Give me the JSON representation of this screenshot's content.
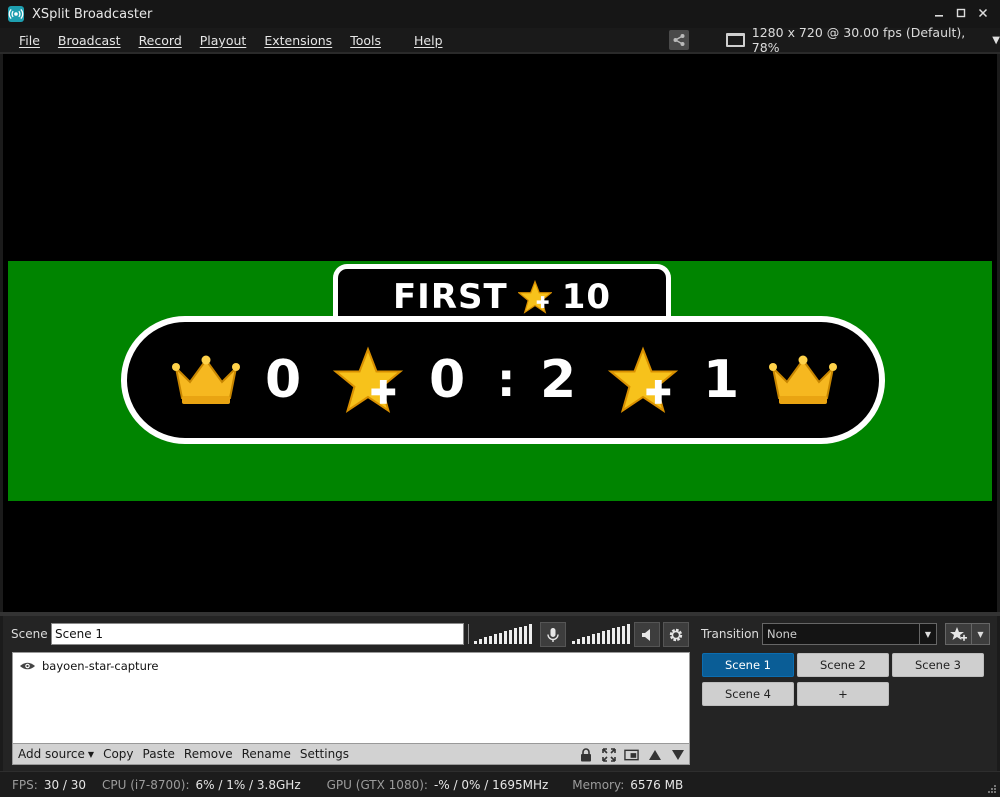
{
  "window": {
    "title": "XSplit Broadcaster",
    "app_icon": "broadcast-icon",
    "controls": [
      "minimize-icon",
      "maximize-icon",
      "close-icon"
    ]
  },
  "menu": {
    "items": [
      "File",
      "Broadcast",
      "Record",
      "Playout",
      "Extensions",
      "Tools",
      "Help"
    ],
    "resolution": "1280 x 720 @ 30.00 fps (Default), 78%"
  },
  "preview": {
    "background_color": "#008400",
    "badge": {
      "label": "FIRST",
      "target": "10"
    },
    "scoreboard": {
      "left_score": "0",
      "left_stars": "0",
      "separator": ":",
      "right_stars": "2",
      "right_score": "1"
    },
    "icons": [
      "crown-icon",
      "star-plus-icon"
    ]
  },
  "scene_panel": {
    "scene_label": "Scene",
    "scene_name": "Scene 1",
    "sources": [
      {
        "name": "bayoen-star-capture",
        "visible": true
      }
    ],
    "toolbar": {
      "add_source": "Add source",
      "copy": "Copy",
      "paste": "Paste",
      "remove": "Remove",
      "rename": "Rename",
      "settings": "Settings"
    }
  },
  "transition": {
    "label": "Transition",
    "value": "None"
  },
  "scenes": {
    "items": [
      "Scene 1",
      "Scene 2",
      "Scene 3",
      "Scene 4"
    ],
    "add_label": "+",
    "active": "Scene 1",
    "active_color": "#0a5d96"
  },
  "status": {
    "fps_label": "FPS:",
    "fps_value": "30 / 30",
    "cpu_label": "CPU (i7-8700):",
    "cpu_value": "6% / 1% / 3.8GHz",
    "gpu_label": "GPU (GTX 1080):",
    "gpu_value": "-% / 0% / 1695MHz",
    "memory_label": "Memory:",
    "memory_value": "6576 MB"
  }
}
